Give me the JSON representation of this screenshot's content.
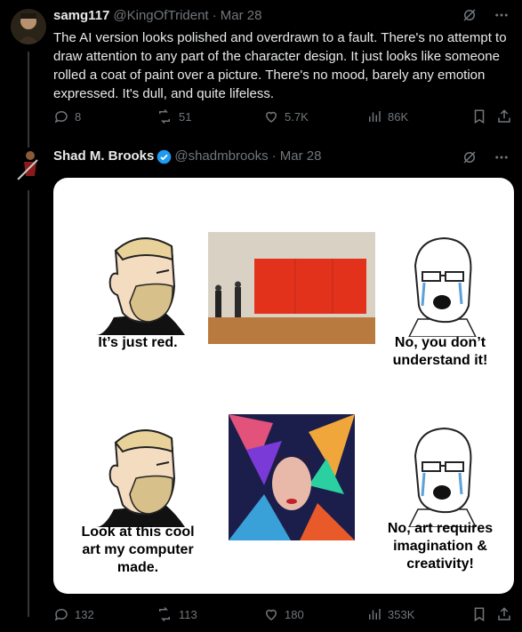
{
  "tweet1": {
    "name": "samg117",
    "handle": "@KingOfTrident",
    "date": "· Mar 28",
    "text": "The AI version looks polished and overdrawn to a fault. There's no attempt to draw attention to any part of the character design. It just looks like someone rolled a coat of paint over a picture. There's no mood, barely any emotion expressed. It's dull, and quite lifeless.",
    "replies": "8",
    "reposts": "51",
    "likes": "5.7K",
    "views": "86K"
  },
  "tweet2": {
    "name": "Shad M. Brooks",
    "handle": "@shadmbrooks",
    "date": "· Mar 28",
    "replies": "132",
    "reposts": "113",
    "likes": "180",
    "views": "353K",
    "meme": {
      "caption_top_left": "It’s just red.",
      "caption_top_right": "No, you don’t understand it!",
      "caption_bottom_left": "Look at this cool art my computer made.",
      "caption_bottom_right": "No, art requires imagination & creativity!"
    }
  },
  "icons": [
    "grok-icon",
    "more-icon",
    "reply-icon",
    "repost-icon",
    "like-icon",
    "views-icon",
    "bookmark-icon",
    "share-icon",
    "verified-badge-icon"
  ],
  "colors": {
    "background": "#000000",
    "text": "#e7e9ea",
    "muted": "#71767b",
    "verified": "#1d9bf0",
    "divider": "#2f3336"
  }
}
